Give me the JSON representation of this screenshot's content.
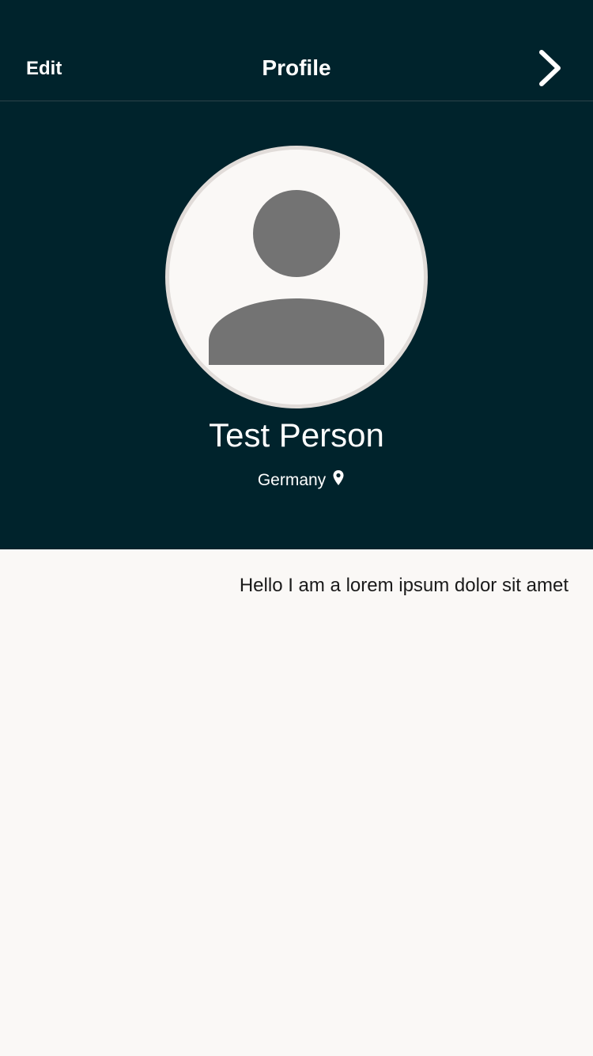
{
  "nav": {
    "edit_label": "Edit",
    "title": "Profile",
    "next_icon": "chevron-right-icon"
  },
  "profile": {
    "avatar_icon": "person-placeholder-icon",
    "name": "Test Person",
    "location": "Germany",
    "location_icon": "map-pin-icon",
    "bio": "Hello I am a lorem ipsum dolor sit amet"
  },
  "colors": {
    "header_bg": "#00232c",
    "page_bg": "#faf8f6",
    "avatar_glyph": "#737373",
    "avatar_border": "#e1dcd9"
  }
}
